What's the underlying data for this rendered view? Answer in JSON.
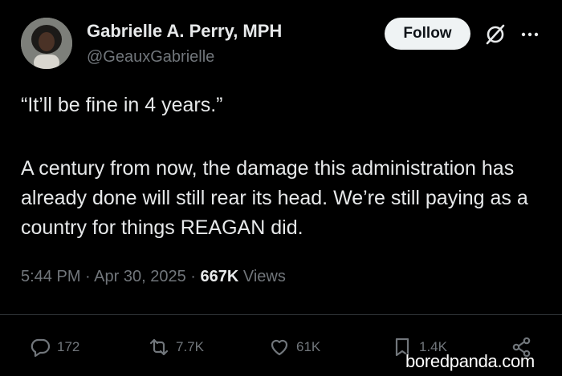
{
  "author": {
    "name": "Gabrielle A. Perry, MPH",
    "handle": "@GeauxGabrielle",
    "avatar_icon": "profile-photo"
  },
  "header": {
    "follow_label": "Follow",
    "grok_icon": "grok-icon",
    "more_icon": "more-icon"
  },
  "tweet": {
    "line_1": "“It’ll be fine in 4 years.”",
    "line_2": "A century from now, the damage this administration has already done will still rear its head. We’re still paying as a country for things REAGAN did.",
    "time": "5:44 PM",
    "date": "Apr 30, 2025",
    "views_count": "667K",
    "views_label": "Views"
  },
  "actions": {
    "replies": "172",
    "retweets": "7.7K",
    "likes": "61K",
    "bookmarks": "1.4K"
  },
  "watermark": "boredpanda.com",
  "colors": {
    "background": "#000000",
    "text": "#e7e9ea",
    "muted": "#71767b",
    "follow_bg": "#eff3f4"
  }
}
